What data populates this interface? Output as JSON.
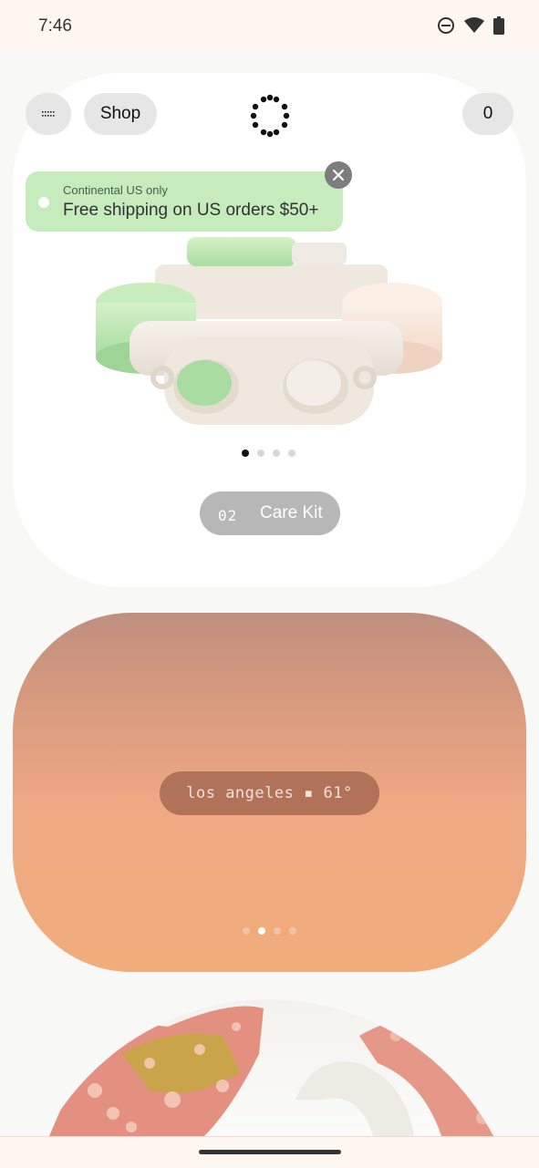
{
  "status_bar": {
    "time": "7:46",
    "icons": [
      "do-not-disturb-icon",
      "wifi-icon",
      "battery-icon"
    ]
  },
  "header": {
    "menu_icon": "menu-icon",
    "shop_label": "Shop",
    "logo_icon": "dotted-ring-logo",
    "cart_count": "0"
  },
  "banner": {
    "small_text": "Continental US only",
    "main_text": "Free shipping on US orders $50+",
    "close_icon": "close-icon",
    "color": "#c6ebbd"
  },
  "hero": {
    "product_image": "care-kit-product-image",
    "carousel_active_index": 0,
    "carousel_count": 4,
    "button_number": "02",
    "button_label": "Care Kit"
  },
  "weather": {
    "text": "los angeles ▪ 61°",
    "carousel_active_index": 1,
    "carousel_count": 4,
    "gradient": [
      "#c08f80",
      "#efa984",
      "#f0ac7a"
    ]
  },
  "art": {
    "image": "abstract-sculpture-image"
  }
}
